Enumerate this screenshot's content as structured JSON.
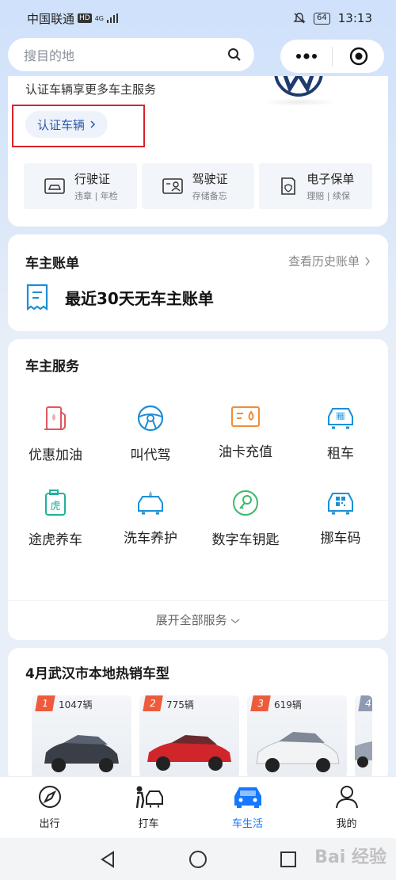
{
  "status_bar": {
    "carrier": "中国联通",
    "hd": "HD",
    "net": "4G",
    "battery": "64",
    "time": "13:13"
  },
  "search": {
    "placeholder": "搜目的地"
  },
  "vehicle_card": {
    "tip": "认证车辆享更多车主服务",
    "verify_button": "认证车辆",
    "docs": [
      {
        "title": "行驶证",
        "sub": "违章 | 年检",
        "icon": "car-license-icon"
      },
      {
        "title": "驾驶证",
        "sub": "存储备忘",
        "icon": "driver-license-icon"
      },
      {
        "title": "电子保单",
        "sub": "理赔 | 续保",
        "icon": "insurance-icon"
      }
    ]
  },
  "bill_card": {
    "title": "车主账单",
    "link": "查看历史账单",
    "message": "最近30天无车主账单"
  },
  "services_card": {
    "title": "车主服务",
    "items": [
      {
        "label": "优惠加油",
        "icon": "fuel-icon"
      },
      {
        "label": "叫代驾",
        "icon": "steering-wheel-icon"
      },
      {
        "label": "油卡充值",
        "icon": "fuel-card-icon"
      },
      {
        "label": "租车",
        "icon": "rent-car-icon"
      },
      {
        "label": "途虎养车",
        "icon": "tuhu-icon"
      },
      {
        "label": "洗车养护",
        "icon": "car-wash-icon"
      },
      {
        "label": "数字车钥匙",
        "icon": "car-key-icon"
      },
      {
        "label": "挪车码",
        "icon": "qr-car-icon"
      }
    ],
    "expand": "展开全部服务"
  },
  "hot_cars": {
    "title": "4月武汉市本地热销车型",
    "cars": [
      {
        "rank": "1",
        "sales": "1047辆",
        "color": "#3a3f47"
      },
      {
        "rank": "2",
        "sales": "775辆",
        "color": "#d0262b"
      },
      {
        "rank": "3",
        "sales": "619辆",
        "color": "#f2f3f5"
      },
      {
        "rank": "4",
        "sales": "",
        "color": "#9aa3b0"
      }
    ]
  },
  "bottom_nav": [
    {
      "label": "出行",
      "icon": "compass-icon"
    },
    {
      "label": "打车",
      "icon": "taxi-icon"
    },
    {
      "label": "车生活",
      "icon": "car-life-icon"
    },
    {
      "label": "我的",
      "icon": "person-icon"
    }
  ],
  "colors": {
    "accent": "#1677ff",
    "verify_text": "#2c58a8",
    "highlight": "#d8232a",
    "rank": "#ee5b3c"
  },
  "watermark": "Bai 经验"
}
